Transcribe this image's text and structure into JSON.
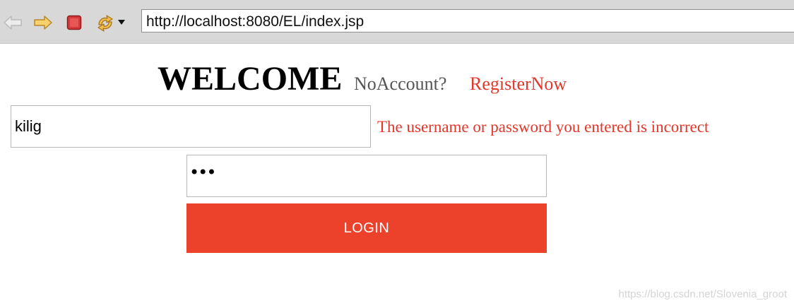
{
  "browser": {
    "url": "http://localhost:8080/EL/index.jsp"
  },
  "page": {
    "welcome": "WELCOME",
    "no_account": "NoAccount?",
    "register_link": "RegisterNow",
    "username_value": "kilig",
    "password_masked": "•••",
    "error_message": "The username or password you entered is incorrect",
    "login_label": "LOGIN"
  },
  "watermark": "https://blog.csdn.net/Slovenia_groot",
  "colors": {
    "accent": "#ec412b",
    "error_text": "#e2372a",
    "toolbar": "#d8d8d8"
  }
}
